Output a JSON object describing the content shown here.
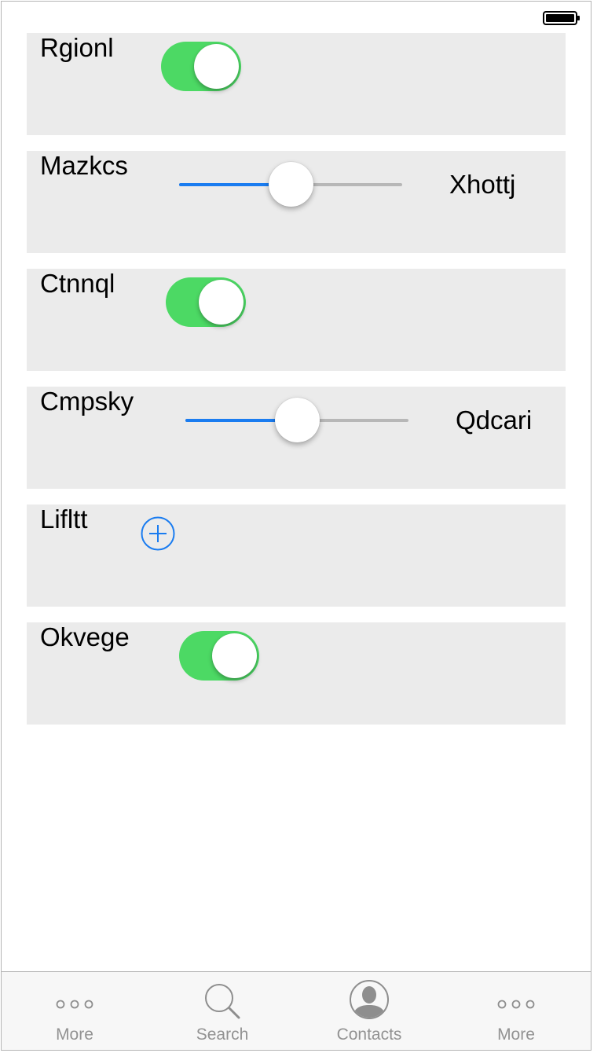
{
  "status_bar": {
    "battery_icon": "battery-full-icon"
  },
  "rows": [
    {
      "label": "Rgionl",
      "control": "toggle",
      "on": true
    },
    {
      "label": "Mazkcs",
      "control": "slider",
      "value": 0.5,
      "value_label": "Xhottj"
    },
    {
      "label": "Ctnnql",
      "control": "toggle",
      "on": true
    },
    {
      "label": "Cmpsky",
      "control": "slider",
      "value": 0.5,
      "value_label": "Qdcari"
    },
    {
      "label": "Lifltt",
      "control": "add",
      "icon": "plus-circle-icon"
    },
    {
      "label": "Okvege",
      "control": "toggle",
      "on": true
    }
  ],
  "tabbar": {
    "tabs": [
      {
        "label": "More",
        "icon": "more-icon"
      },
      {
        "label": "Search",
        "icon": "search-icon"
      },
      {
        "label": "Contacts",
        "icon": "contacts-icon"
      },
      {
        "label": "More",
        "icon": "more-icon"
      }
    ]
  },
  "colors": {
    "toggle_on": "#4cd964",
    "slider_fill": "#1a7cf0",
    "slider_track": "#b7b7b7",
    "row_background": "#ebebeb",
    "tab_label": "#929292"
  }
}
